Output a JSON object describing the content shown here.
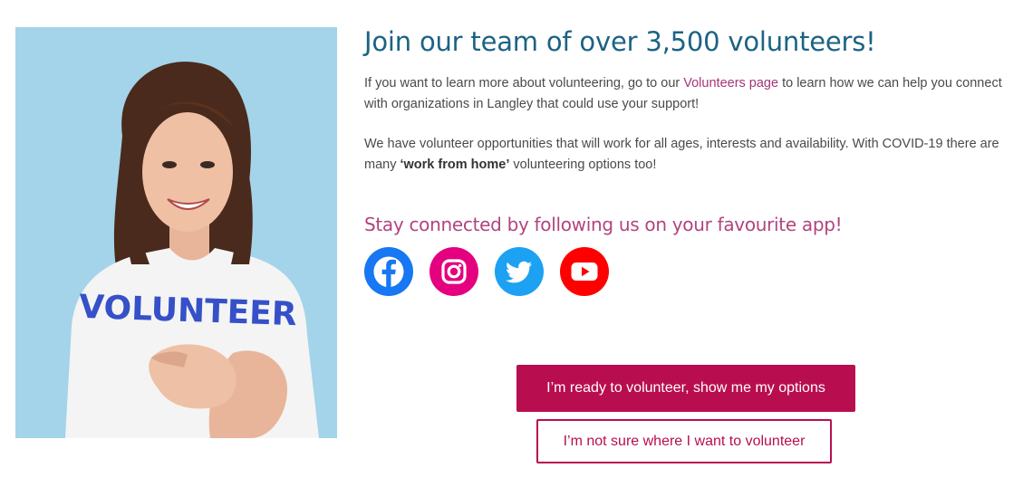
{
  "photo": {
    "shirt_text": "VOLUNTEER"
  },
  "main": {
    "heading": "Join our team of over 3,500 volunteers!",
    "para1_before": "If you want to learn more about volunteering, go to our ",
    "para1_link": "Volunteers page",
    "para1_after": " to learn how we can help you connect with organizations in Langley that could use your support!",
    "para2_before": "We have volunteer opportunities that will work for all ages, interests and availability. With COVID-19 there are many ",
    "para2_bold": "‘work from home’",
    "para2_after": " volunteering options too!",
    "subheading": "Stay connected by following us on your favourite app!"
  },
  "social": [
    {
      "icon": "facebook-icon",
      "color": "#1877f2"
    },
    {
      "icon": "instagram-icon",
      "color": "#e4007f"
    },
    {
      "icon": "twitter-icon",
      "color": "#1da1f2"
    },
    {
      "icon": "youtube-icon",
      "color": "#ff0000"
    }
  ],
  "buttons": {
    "primary_label": "I’m ready to volunteer, show me my options",
    "secondary_label": "I’m not sure where I want to volunteer"
  },
  "colors": {
    "heading": "#1c6383",
    "accent": "#b80e4f",
    "subheading": "#b0457f",
    "link": "#a53579",
    "photo_bg": "#a6d6ea"
  }
}
